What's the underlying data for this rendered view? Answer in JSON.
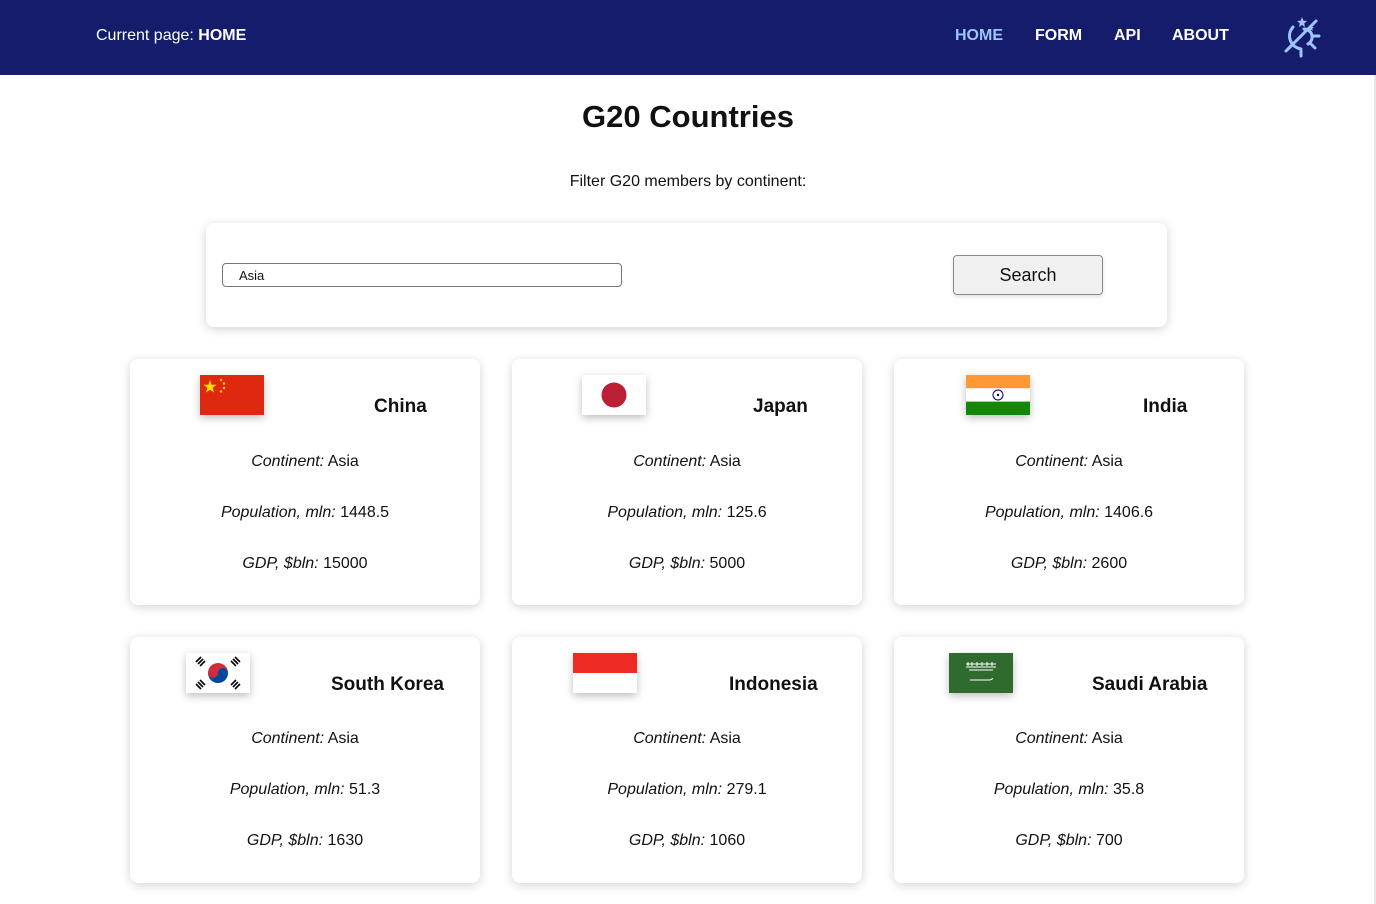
{
  "nav": {
    "current_page_label": "Current page:",
    "current_page_value": "HOME",
    "links": [
      {
        "label": "HOME",
        "active": true
      },
      {
        "label": "FORM",
        "active": false
      },
      {
        "label": "API",
        "active": false
      },
      {
        "label": "ABOUT",
        "active": false
      }
    ],
    "theme_icon": "sun-moon-icon"
  },
  "page": {
    "title": "G20 Countries",
    "filter_label": "Filter G20 members by continent:"
  },
  "search": {
    "value": "Asia",
    "button_label": "Search"
  },
  "labels": {
    "continent": "Continent:",
    "population": "Population, mln:",
    "gdp": "GDP, $bln:"
  },
  "countries": [
    {
      "name": "China",
      "continent": "Asia",
      "population": "1448.5",
      "gdp": "15000",
      "flag": "china-flag-icon"
    },
    {
      "name": "Japan",
      "continent": "Asia",
      "population": "125.6",
      "gdp": "5000",
      "flag": "japan-flag-icon"
    },
    {
      "name": "India",
      "continent": "Asia",
      "population": "1406.6",
      "gdp": "2600",
      "flag": "india-flag-icon"
    },
    {
      "name": "South Korea",
      "continent": "Asia",
      "population": "51.3",
      "gdp": "1630",
      "flag": "south-korea-flag-icon"
    },
    {
      "name": "Indonesia",
      "continent": "Asia",
      "population": "279.1",
      "gdp": "1060",
      "flag": "indonesia-flag-icon"
    },
    {
      "name": "Saudi Arabia",
      "continent": "Asia",
      "population": "35.8",
      "gdp": "700",
      "flag": "saudi-arabia-flag-icon"
    }
  ],
  "colors": {
    "navbar": "#141c6b",
    "nav_active": "#9ec5ff"
  }
}
